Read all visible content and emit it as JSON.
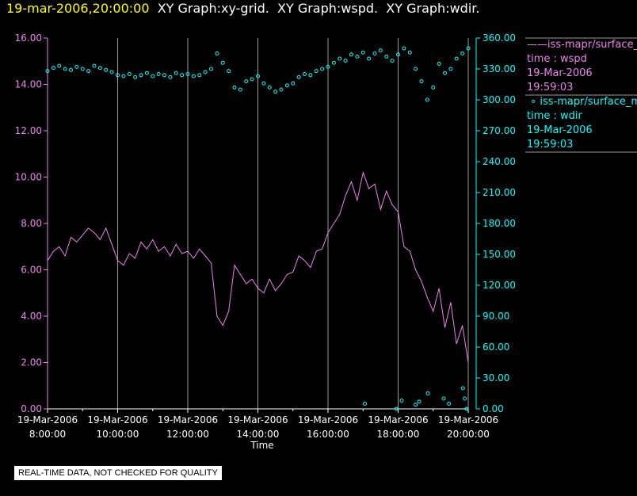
{
  "title": {
    "datetime": "19-mar-2006,20:00:00",
    "parts": [
      "XY Graph:xy-grid.",
      "XY Graph:wspd.",
      "XY Graph:wdir."
    ]
  },
  "legend": [
    {
      "symbol": "line",
      "label": "iss-mapr/surface_m",
      "var": "time : wspd",
      "date": "19-Mar-2006",
      "time": "19:59:03"
    },
    {
      "symbol": "circle",
      "label": "iss-mapr/surface_m",
      "var": "time : wdir",
      "date": "19-Mar-2006",
      "time": "19:59:03"
    }
  ],
  "disclaimer": "REAL-TIME DATA, NOT CHECKED FOR QUALITY",
  "colors": {
    "wspd": "#ee82ee",
    "wdir": "#00ffff",
    "grid": "#9a9a9a",
    "title_date": "#ffff00"
  },
  "chart_data": {
    "type": "line",
    "xlabel": "Time",
    "xlim_hours": [
      8,
      20
    ],
    "x_ticks": [
      {
        "h": 8,
        "d": "19-Mar-2006",
        "t": "8:00:00"
      },
      {
        "h": 10,
        "d": "19-Mar-2006",
        "t": "10:00:00"
      },
      {
        "h": 12,
        "d": "19-Mar-2006",
        "t": "12:00:00"
      },
      {
        "h": 14,
        "d": "19-Mar-2006",
        "t": "14:00:00"
      },
      {
        "h": 16,
        "d": "19-Mar-2006",
        "t": "16:00:00"
      },
      {
        "h": 18,
        "d": "19-Mar-2006",
        "t": "18:00:00"
      },
      {
        "h": 20,
        "d": "19-Mar-2006",
        "t": "20:00:00"
      }
    ],
    "y_left": {
      "lim": [
        0,
        16
      ],
      "ticks": [
        "0.00",
        "2.00",
        "4.00",
        "6.00",
        "8.00",
        "10.00",
        "12.00",
        "14.00",
        "16.00"
      ]
    },
    "y_right": {
      "lim": [
        0,
        360
      ],
      "ticks": [
        "0.00",
        "30.00",
        "60.00",
        "90.00",
        "120.00",
        "150.00",
        "180.00",
        "210.00",
        "240.00",
        "270.00",
        "300.00",
        "330.00",
        "360.00"
      ]
    },
    "series": [
      {
        "name": "wspd",
        "axis": "left",
        "style": "line",
        "start_hour": 8,
        "step_min": 10,
        "values": [
          6.4,
          6.8,
          7.0,
          6.6,
          7.4,
          7.2,
          7.5,
          7.8,
          7.6,
          7.3,
          7.8,
          7.1,
          6.4,
          6.2,
          6.7,
          6.5,
          7.2,
          6.9,
          7.3,
          6.8,
          7.0,
          6.6,
          7.1,
          6.7,
          6.8,
          6.5,
          6.9,
          6.6,
          6.3,
          4.0,
          3.6,
          4.2,
          6.2,
          5.8,
          5.4,
          5.6,
          5.2,
          5.0,
          5.6,
          5.1,
          5.4,
          5.8,
          5.9,
          6.6,
          6.4,
          6.1,
          6.8,
          6.9,
          7.6,
          8.0,
          8.4,
          9.2,
          9.8,
          9.0,
          10.2,
          9.5,
          9.7,
          8.6,
          9.4,
          8.8,
          8.5,
          7.0,
          6.8,
          6.0,
          5.5,
          4.8,
          4.2,
          5.2,
          3.5,
          4.6,
          2.8,
          3.6,
          2.0
        ]
      },
      {
        "name": "wdir",
        "axis": "right",
        "style": "circle",
        "start_hour": 8,
        "step_min": 10,
        "values": [
          328,
          331,
          333,
          330,
          329,
          332,
          330,
          328,
          333,
          331,
          329,
          327,
          324,
          323,
          325,
          322,
          324,
          326,
          323,
          325,
          324,
          322,
          326,
          324,
          325,
          323,
          324,
          327,
          330,
          345,
          336,
          328,
          312,
          310,
          318,
          320,
          323,
          316,
          312,
          308,
          310,
          314,
          316,
          322,
          325,
          324,
          328,
          330,
          332,
          336,
          340,
          338,
          344,
          342,
          346,
          340,
          345,
          348,
          342,
          338,
          344,
          350,
          346,
          330,
          318,
          300,
          312,
          335,
          326,
          330,
          340,
          345,
          350
        ],
        "outliers": [
          [
            17.05,
            5
          ],
          [
            17.95,
            0
          ],
          [
            18.1,
            8
          ],
          [
            18.5,
            4
          ],
          [
            18.6,
            7
          ],
          [
            18.85,
            15
          ],
          [
            19.3,
            10
          ],
          [
            19.45,
            5
          ],
          [
            19.85,
            20
          ],
          [
            19.9,
            10
          ],
          [
            19.95,
            0
          ]
        ]
      }
    ]
  }
}
